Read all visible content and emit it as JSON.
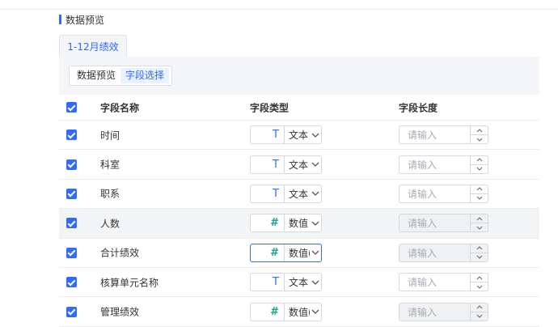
{
  "section": {
    "title": "数据预览"
  },
  "tab": {
    "label": "1-12月绩效"
  },
  "segment": {
    "items": [
      "数据预览",
      "字段选择"
    ],
    "active_index": 1
  },
  "table": {
    "columns": [
      "字段名称",
      "字段类型",
      "字段长度"
    ],
    "rows": [
      {
        "name": "时间",
        "type_icon": "T",
        "type_label": "文本",
        "length_placeholder": "请输入",
        "length_disabled": false,
        "checked": true
      },
      {
        "name": "科室",
        "type_icon": "T",
        "type_label": "文本",
        "length_placeholder": "请输入",
        "length_disabled": false,
        "checked": true
      },
      {
        "name": "职系",
        "type_icon": "T",
        "type_label": "文本",
        "length_placeholder": "请输入",
        "length_disabled": false,
        "checked": true
      },
      {
        "name": "人数",
        "type_icon": "#",
        "type_label": "数值",
        "length_placeholder": "请输入",
        "length_disabled": true,
        "checked": true
      },
      {
        "name": "合计绩效",
        "type_icon": "#",
        "type_label": "数值(",
        "length_placeholder": "请输入",
        "length_disabled": true,
        "checked": true
      },
      {
        "name": "核算单元名称",
        "type_icon": "T",
        "type_label": "文本",
        "length_placeholder": "请输入",
        "length_disabled": false,
        "checked": true
      },
      {
        "name": "管理绩效",
        "type_icon": "#",
        "type_label": "数值(",
        "length_placeholder": "请输入",
        "length_disabled": true,
        "checked": true
      }
    ]
  },
  "colors": {
    "accent": "#2f6bff",
    "number_icon": "#18a68f"
  }
}
